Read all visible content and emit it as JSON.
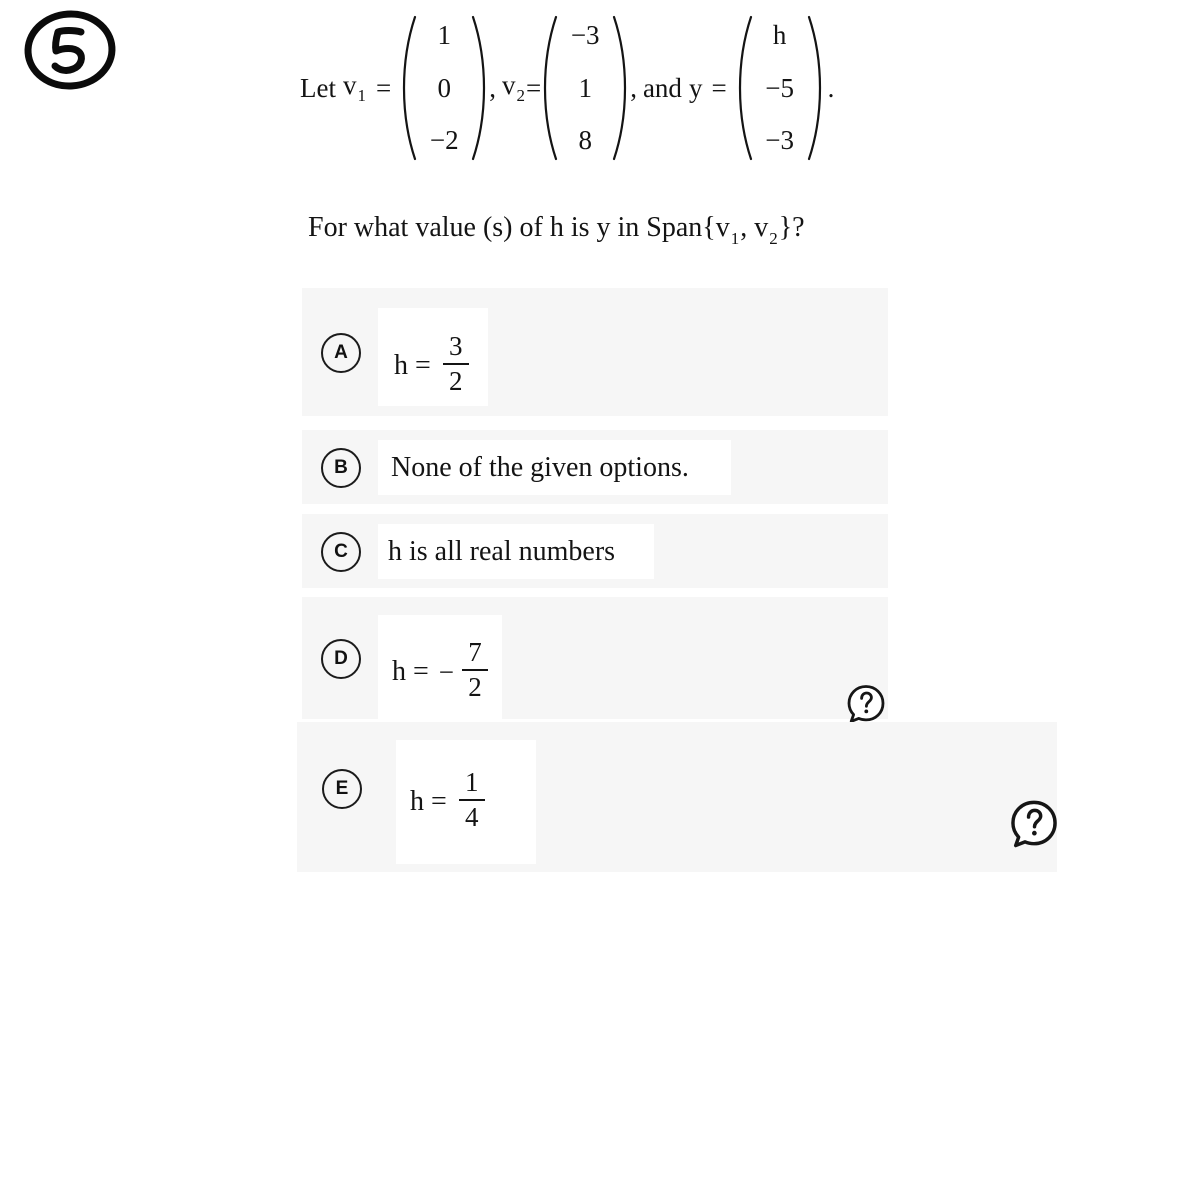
{
  "question_number": "5",
  "problem": {
    "lead_text": "Let",
    "variables": [
      {
        "name": "v",
        "subscript": "1",
        "entries": [
          "1",
          "0",
          "−2"
        ]
      },
      {
        "name": "v",
        "subscript": "2",
        "entries": [
          "−3",
          "1",
          "8"
        ]
      },
      {
        "name": "y",
        "subscript": "",
        "entries": [
          "h",
          "−5",
          "−3"
        ]
      }
    ],
    "conjunction": "and",
    "equals": "=",
    "comma": ",",
    "terminator": ".",
    "question": "For what value (s)  of h is y in Span{v₁, v₂}?",
    "question_parts": {
      "prefix": "For what value (s)  of h is y in Span{",
      "v1_name": "v",
      "v1_sub": "1",
      "separator": ", ",
      "v2_name": "v",
      "v2_sub": "2",
      "suffix": "}?"
    }
  },
  "options": [
    {
      "letter": "A",
      "kind": "fraction",
      "lhs": "h =",
      "negative": false,
      "numerator": "3",
      "denominator": "2",
      "plain_text": ""
    },
    {
      "letter": "B",
      "kind": "text",
      "lhs": "",
      "negative": false,
      "numerator": "",
      "denominator": "",
      "plain_text": "None of the given options."
    },
    {
      "letter": "C",
      "kind": "text",
      "lhs": "",
      "negative": false,
      "numerator": "",
      "denominator": "",
      "plain_text": "h is all real numbers"
    },
    {
      "letter": "D",
      "kind": "fraction",
      "lhs": "h =",
      "negative": true,
      "negative_sign": "−",
      "numerator": "7",
      "denominator": "2",
      "plain_text": ""
    },
    {
      "letter": "E",
      "kind": "fraction",
      "lhs": "h =",
      "negative": false,
      "numerator": "1",
      "denominator": "4",
      "plain_text": ""
    }
  ],
  "help_icons": [
    {
      "name": "help-bubble-d",
      "glyph": "?"
    },
    {
      "name": "help-bubble-e",
      "glyph": "?"
    }
  ],
  "colors": {
    "page_background": "#ffffff",
    "band_background": "#f6f6f6",
    "inner_background": "#ffffff",
    "text": "#141414",
    "bullet_outline": "#1b1b1b"
  }
}
